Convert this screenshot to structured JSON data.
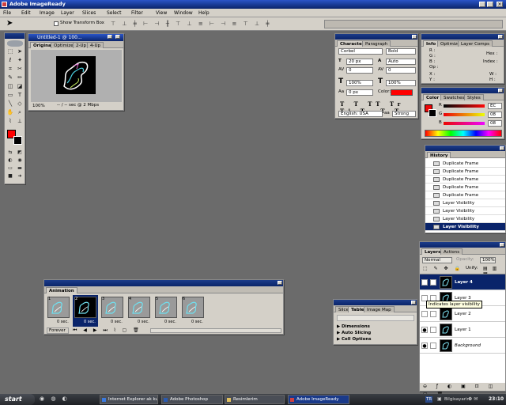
{
  "app": {
    "title": "Adobe ImageReady",
    "icon": "imageready-icon"
  },
  "menu": [
    "File",
    "Edit",
    "Image",
    "Layer",
    "Slices",
    "Select",
    "Filter",
    "View",
    "Window",
    "Help"
  ],
  "options": {
    "show_transform_box": "Show Transform Box"
  },
  "doc": {
    "title": "Untitled-1 @ 100...",
    "tabs": [
      "Original",
      "Optimized",
      "2-Up",
      "4-Up"
    ],
    "zoom": "100%",
    "status": "-- / -- sec @ 2 Mbps"
  },
  "character": {
    "tabs": [
      "Character",
      "Paragraph"
    ],
    "font": "Corbel",
    "style": "Bold",
    "size": "20 px",
    "leading": "Auto",
    "kern": "0",
    "track": "0",
    "scale_v": "100%",
    "scale_h": "100%",
    "baseline": "0 px",
    "color_label": "Color:",
    "language": "English: USA",
    "aa": "Strong",
    "color": "#ff0000"
  },
  "info": {
    "tabs": [
      "Info",
      "Optimize",
      "Layer Comps"
    ],
    "r": "R :",
    "g": "G :",
    "b": "B :",
    "op": "Op :",
    "hex": "Hex :",
    "index": "Index :",
    "x": "X :",
    "y": "Y :",
    "w": "W :",
    "h": "H :"
  },
  "color": {
    "tabs": [
      "Color",
      "Swatches",
      "Styles"
    ],
    "r": "R",
    "g": "G",
    "b": "B",
    "r_val": "EC",
    "g_val": "08",
    "b_val": "08"
  },
  "history": {
    "tabs": [
      "History"
    ],
    "items": [
      "Duplicate Frame",
      "Duplicate Frame",
      "Duplicate Frame",
      "Duplicate Frame",
      "Duplicate Frame",
      "Layer Visibility",
      "Layer Visibility",
      "Layer Visibility",
      "Layer Visibility"
    ],
    "selected": 8
  },
  "layers": {
    "tabs": [
      "Layers",
      "Actions"
    ],
    "mode": "Normal",
    "opacity_label": "Opacity:",
    "opacity": "100%",
    "unify": "Unify:",
    "items": [
      "Layer 4",
      "Layer 3",
      "Layer 2",
      "Layer 1",
      "Background"
    ],
    "selected": 0,
    "tooltip": "Indicates layer visibility"
  },
  "slice": {
    "tabs": [
      "Slice",
      "Table",
      "Image Map"
    ],
    "sections": [
      "Dimensions",
      "Auto Slicing",
      "Cell Options"
    ]
  },
  "animation": {
    "title": "Animation",
    "frames": [
      {
        "n": "1",
        "t": "0 sec."
      },
      {
        "n": "2",
        "t": "0 sec."
      },
      {
        "n": "3",
        "t": "0 sec."
      },
      {
        "n": "4",
        "t": "0 sec."
      },
      {
        "n": "5",
        "t": "0 sec."
      },
      {
        "n": "6",
        "t": "0 sec."
      }
    ],
    "selected": 1,
    "loop": "Forever"
  },
  "taskbar": {
    "start": "start",
    "items": [
      "Internet Explorer ak kull...",
      "Adobe Photoshop",
      "Resimlerim",
      "Adobe ImageReady"
    ],
    "active": 3,
    "lang": "TR",
    "user": "Bilgisayarim",
    "clock": "23:10"
  }
}
